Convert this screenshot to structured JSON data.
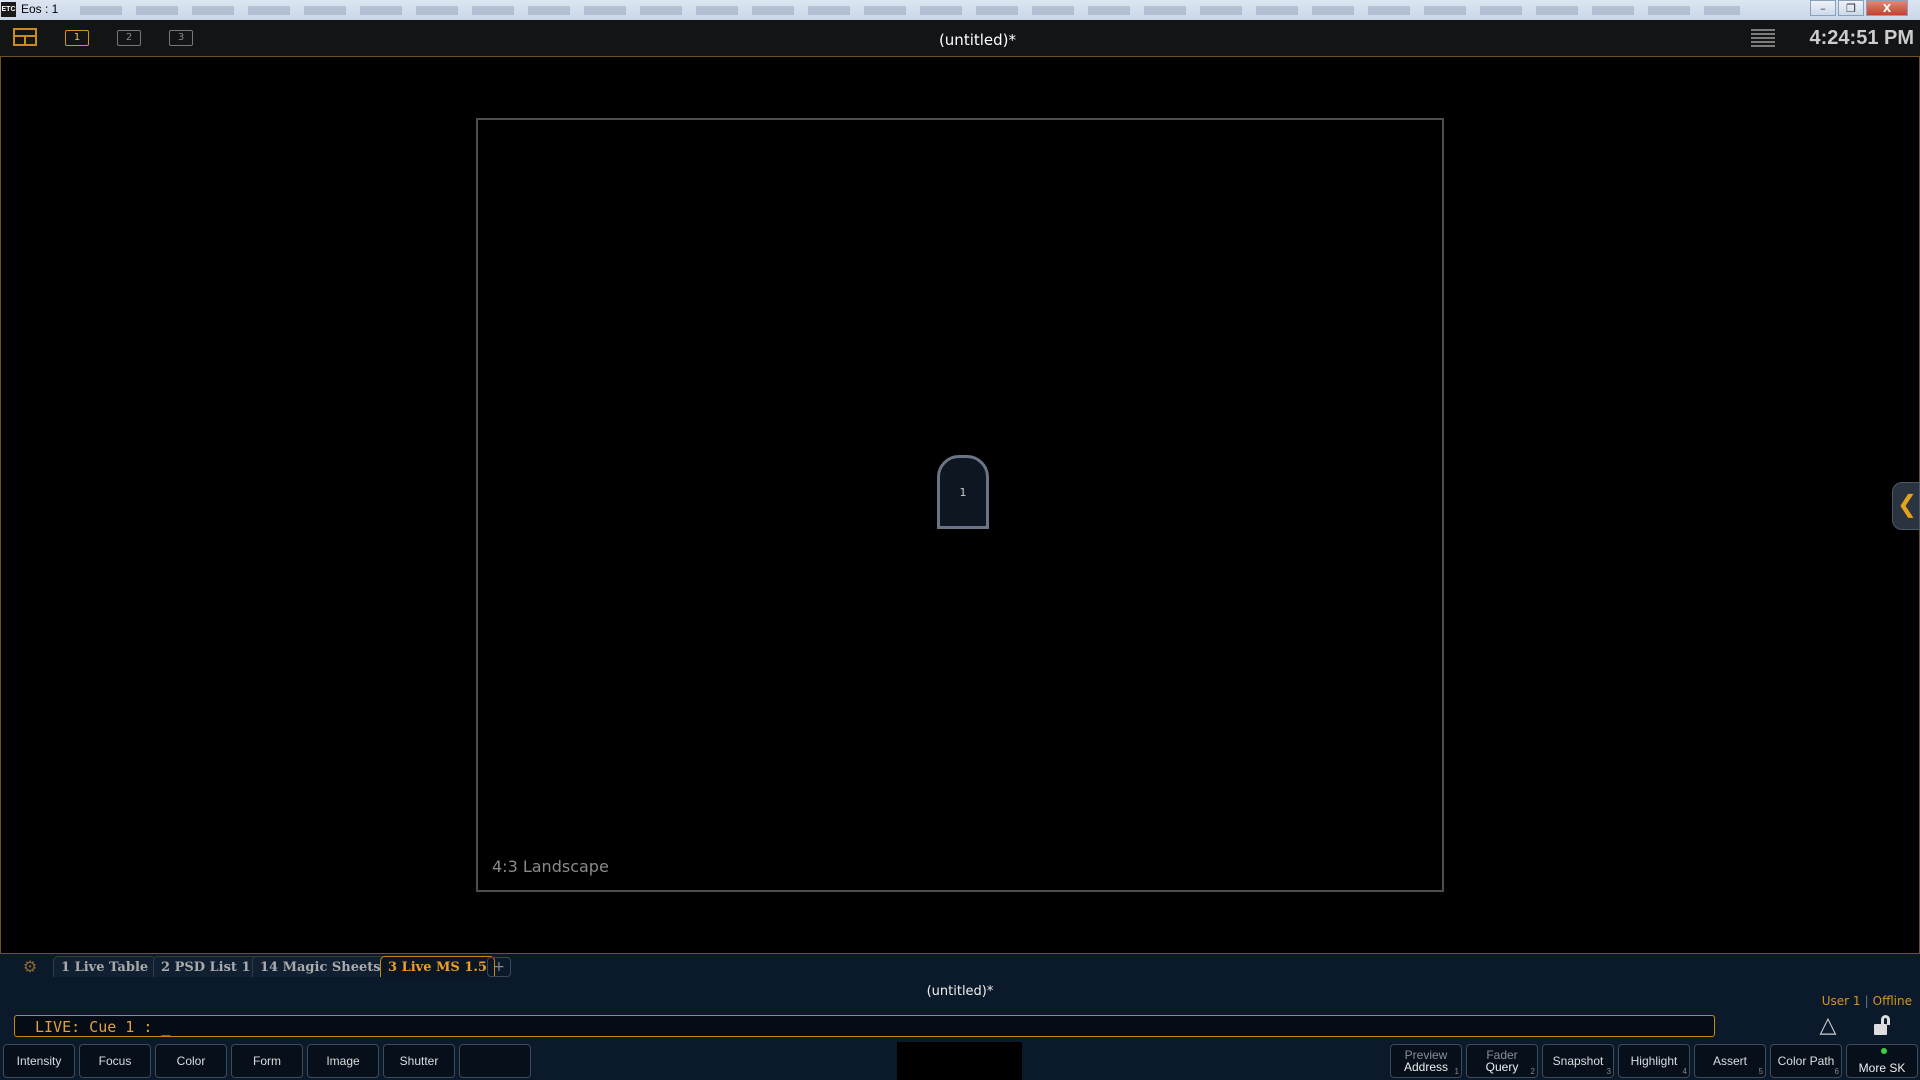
{
  "window": {
    "title": "Eos : 1",
    "app_icon_label": "ETC",
    "minimize_glyph": "–",
    "maximize_glyph": "❐",
    "close_glyph": "X"
  },
  "toolbar": {
    "title": "(untitled)*",
    "pages": [
      "1",
      "2",
      "3"
    ],
    "active_page": "1",
    "clock": "4:24:51 PM"
  },
  "magic_sheet": {
    "aspect_label": "4:3 Landscape",
    "channel": "1"
  },
  "tabs": {
    "items": [
      {
        "label": "1 Live Table",
        "active": false
      },
      {
        "label": "2 PSD List 1",
        "active": false
      },
      {
        "label": "14 Magic Sheets",
        "active": false
      },
      {
        "label": "3 Live MS 1.5",
        "active": true
      }
    ],
    "add_label": "+"
  },
  "status": {
    "show_title": "(untitled)*",
    "user": "User 1",
    "separator": "|",
    "mode": "Offline",
    "command_line": "LIVE: Cue  1 :  _"
  },
  "softkeys_left": [
    "Intensity",
    "Focus",
    "Color",
    "Form",
    "Image",
    "Shutter",
    ""
  ],
  "softkeys_right": [
    {
      "line1": "Preview",
      "line2": "Address",
      "num": "1"
    },
    {
      "line1": "Fader",
      "line2": "Query",
      "num": "2"
    },
    {
      "label": "Snapshot",
      "num": "3"
    },
    {
      "label": "Highlight",
      "num": "4"
    },
    {
      "label": "Assert",
      "num": "5"
    },
    {
      "label": "Color Path",
      "num": "6"
    },
    {
      "label": "More SK",
      "led": true
    }
  ],
  "icons": {
    "gear": "⚙",
    "triangle": "△",
    "collapse": "❮"
  },
  "colors": {
    "accent": "#d6951e",
    "status_led": "#3bd14a"
  }
}
